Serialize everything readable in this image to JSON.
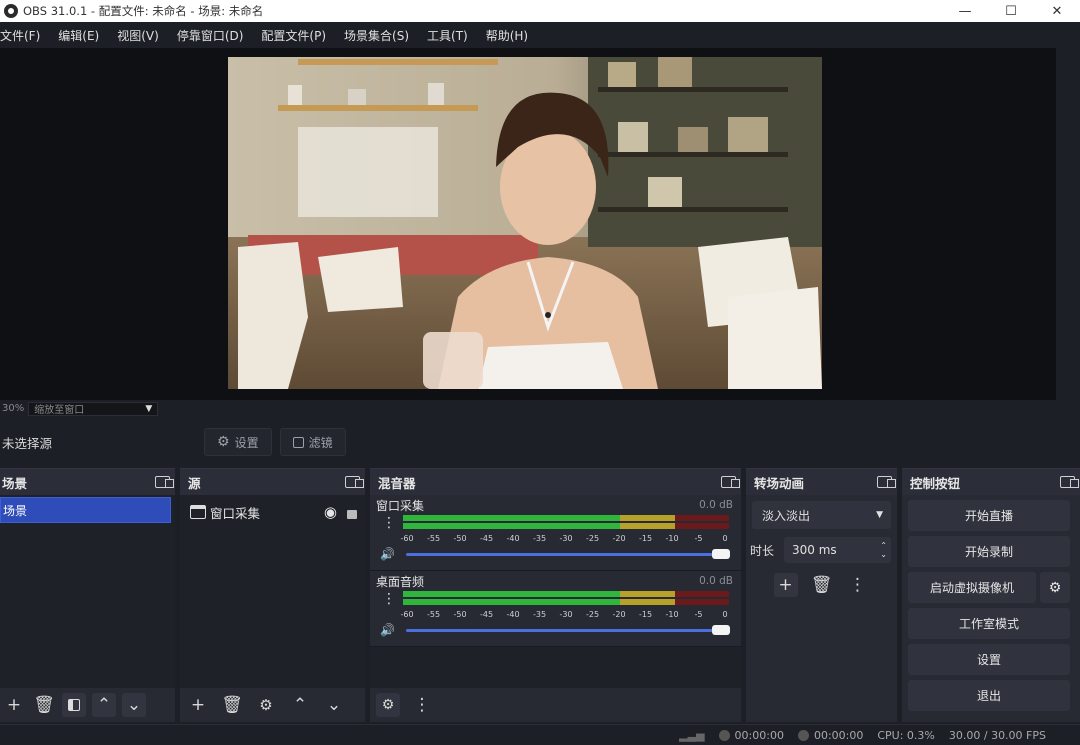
{
  "window": {
    "title": "OBS 31.0.1 - 配置文件: 未命名 - 场景: 未命名",
    "minimize": "—",
    "maximize": "☐",
    "close": "✕"
  },
  "menu": [
    "文件(F)",
    "编辑(E)",
    "视图(V)",
    "停靠窗口(D)",
    "配置文件(P)",
    "场景集合(S)",
    "工具(T)",
    "帮助(H)"
  ],
  "preview": {
    "zoom": "30%",
    "zoom_mode": "缩放至窗口"
  },
  "toolbar": {
    "no_source": "未选择源",
    "properties": "设置",
    "filters": "滤镜"
  },
  "scenes": {
    "title": "场景",
    "items": [
      "场景"
    ]
  },
  "sources": {
    "title": "源",
    "items": [
      {
        "name": "窗口采集"
      }
    ]
  },
  "mixer": {
    "title": "混音器",
    "channels": [
      {
        "name": "窗口采集",
        "db": "0.0 dB",
        "level_fraction": 0.9
      },
      {
        "name": "桌面音频",
        "db": "0.0 dB",
        "level_fraction": 0.9
      }
    ],
    "ticks": [
      "-60",
      "-55",
      "-50",
      "-45",
      "-40",
      "-35",
      "-30",
      "-25",
      "-20",
      "-15",
      "-10",
      "-5",
      "0"
    ]
  },
  "transitions": {
    "title": "转场动画",
    "selected": "淡入淡出",
    "duration_label": "时长",
    "duration": "300 ms"
  },
  "controls": {
    "title": "控制按钮",
    "start_stream": "开始直播",
    "start_record": "开始录制",
    "virtual_cam": "启动虚拟摄像机",
    "studio_mode": "工作室模式",
    "settings": "设置",
    "exit": "退出"
  },
  "status": {
    "stream_time": "00:00:00",
    "record_time": "00:00:00",
    "cpu": "CPU: 0.3%",
    "fps": "30.00 / 30.00 FPS"
  },
  "colors": {
    "accent": "#2f4db8",
    "meter_green": "#31b63d",
    "meter_yellow": "#b8a12a",
    "meter_red": "#b22a2a"
  }
}
